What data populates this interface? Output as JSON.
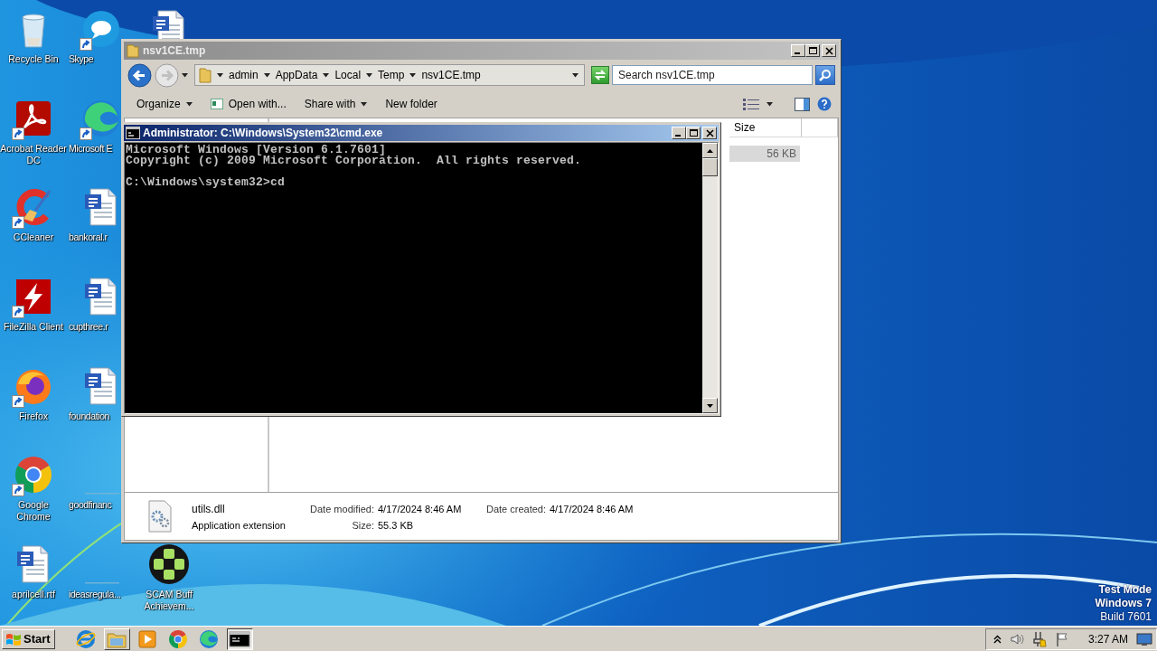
{
  "desktop": {
    "icon_columns": [
      [
        {
          "label": "Recycle Bin",
          "kind": "recycle-bin",
          "shortcut": false
        },
        {
          "label": "Acrobat Reader DC",
          "kind": "acrobat",
          "shortcut": true
        },
        {
          "label": "CCleaner",
          "kind": "ccleaner",
          "shortcut": true
        },
        {
          "label": "FileZilla Client",
          "kind": "filezilla",
          "shortcut": true
        },
        {
          "label": "Firefox",
          "kind": "firefox",
          "shortcut": true
        },
        {
          "label": "Google Chrome",
          "kind": "chrome",
          "shortcut": true
        },
        {
          "label": "aprilcell.rtf",
          "kind": "word-doc",
          "shortcut": false
        }
      ],
      [
        {
          "label": "Skype",
          "kind": "skype",
          "shortcut": true
        },
        {
          "label": "Microsoft E",
          "kind": "edge",
          "shortcut": true
        },
        {
          "label": "bankoral.r",
          "kind": "word-doc",
          "shortcut": false
        },
        {
          "label": "cupthree.r",
          "kind": "word-doc",
          "shortcut": false
        },
        {
          "label": "foundation",
          "kind": "word-doc",
          "shortcut": false
        },
        {
          "label": "goodfinanc",
          "kind": "blank",
          "shortcut": false
        },
        {
          "label": "ideasregula...",
          "kind": "blank",
          "shortcut": false
        }
      ],
      [
        {
          "kind": "word-doc",
          "shortcut": false
        },
        {
          "label": "SCAM Buff Achievem...",
          "kind": "gamepad",
          "shortcut": false
        }
      ]
    ],
    "os_notice": [
      {
        "text": "Test Mode",
        "bold": true
      },
      {
        "text": "Windows 7",
        "bold": true
      },
      {
        "text": "Build 7601",
        "bold": false
      }
    ]
  },
  "explorer": {
    "title": "nsv1CE.tmp",
    "breadcrumb": [
      "admin",
      "AppData",
      "Local",
      "Temp",
      "nsv1CE.tmp"
    ],
    "search": {
      "placeholder": "Search nsv1CE.tmp"
    },
    "toolbar": [
      {
        "label": "Organize",
        "kind": "menu"
      },
      {
        "label": "Open with...",
        "kind": "icon"
      },
      {
        "label": "Share with",
        "kind": "menu"
      },
      {
        "label": "New folder",
        "kind": "plain"
      }
    ],
    "columns": [
      {
        "label": "Size"
      }
    ],
    "rows": [
      {
        "size": "56 KB",
        "selected": true
      }
    ],
    "details": {
      "name": "utils.dll",
      "type": "Application extension",
      "fields": [
        {
          "label": "Date modified:",
          "value": "4/17/2024 8:46 AM"
        },
        {
          "label": "Size:",
          "value": "55.3 KB"
        },
        {
          "label": "Date created:",
          "value": "4/17/2024 8:46 AM"
        }
      ]
    }
  },
  "cmd": {
    "title": "Administrator: C:\\Windows\\System32\\cmd.exe",
    "blocks": [
      [
        "Microsoft Windows [Version 6.1.7601]",
        "Copyright (c) 2009 Microsoft Corporation.  All rights reserved."
      ],
      [
        "C:\\Windows\\system32>cd"
      ]
    ]
  },
  "taskbar": {
    "start": "Start",
    "apps": [
      {
        "kind": "ie",
        "open": false,
        "active": false
      },
      {
        "kind": "folder",
        "open": true,
        "active": false
      },
      {
        "kind": "media",
        "open": false,
        "active": false
      },
      {
        "kind": "chrome",
        "open": false,
        "active": false
      },
      {
        "kind": "edge",
        "open": false,
        "active": false
      },
      {
        "kind": "cmd",
        "open": true,
        "active": true
      }
    ],
    "clock": "3:27 AM"
  }
}
